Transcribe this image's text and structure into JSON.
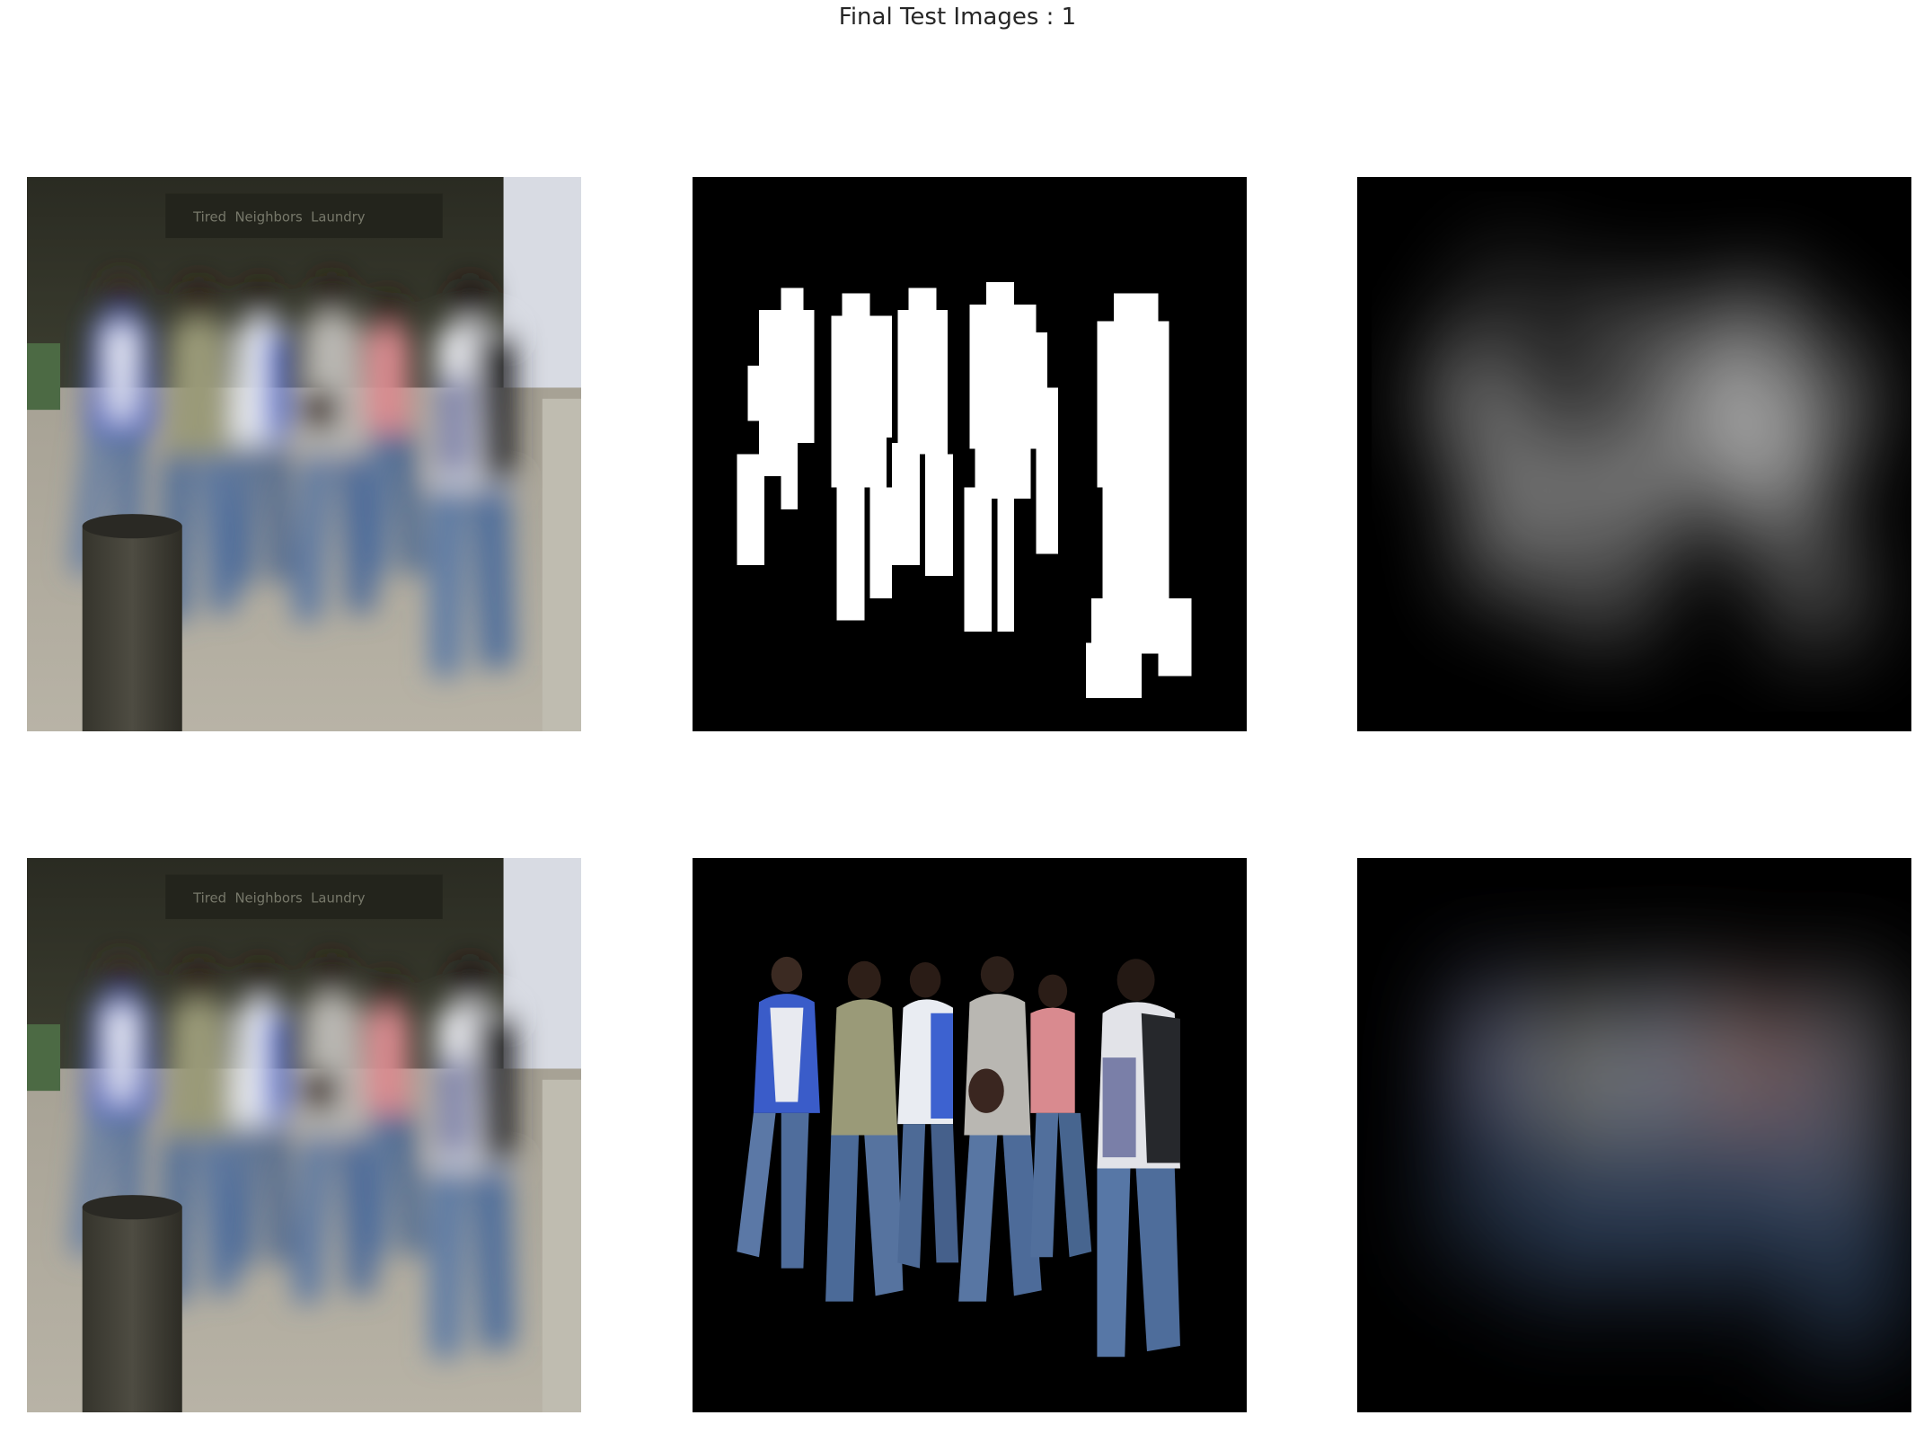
{
  "figure": {
    "title": "Final Test Images : 1"
  },
  "panels": [
    {
      "row": 0,
      "col": 0,
      "kind": "input-photo"
    },
    {
      "row": 0,
      "col": 1,
      "kind": "ground-truth-mask"
    },
    {
      "row": 0,
      "col": 2,
      "kind": "predicted-mask"
    },
    {
      "row": 1,
      "col": 0,
      "kind": "input-photo"
    },
    {
      "row": 1,
      "col": 1,
      "kind": "ground-truth-masked-photo"
    },
    {
      "row": 1,
      "col": 2,
      "kind": "predicted-masked-photo"
    }
  ],
  "colors": {
    "background": "#ffffff",
    "mask_background": "#000000",
    "mask_foreground": "#ffffff",
    "denim": "#4f6d9c",
    "jacket_blue": "#3a5cc9",
    "building_dark": "#2e2f24",
    "pavement": "#a9a396"
  }
}
